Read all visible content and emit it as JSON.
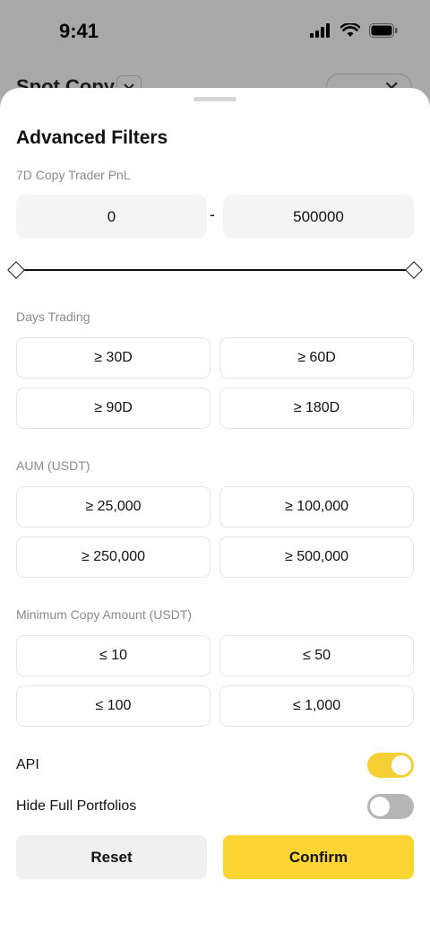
{
  "status_bar": {
    "time": "9:41"
  },
  "background": {
    "title": "Spot Copy"
  },
  "sheet": {
    "title": "Advanced Filters",
    "pnl": {
      "label": "7D Copy Trader PnL",
      "min": "0",
      "max": "500000",
      "separator": "-"
    },
    "days_trading": {
      "label": "Days Trading",
      "options": [
        "≥ 30D",
        "≥ 60D",
        "≥ 90D",
        "≥ 180D"
      ]
    },
    "aum": {
      "label": "AUM (USDT)",
      "options": [
        "≥ 25,000",
        "≥ 100,000",
        "≥ 250,000",
        "≥ 500,000"
      ]
    },
    "min_copy": {
      "label": "Minimum Copy Amount (USDT)",
      "options": [
        "≤ 10",
        "≤ 50",
        "≤ 100",
        "≤ 1,000"
      ]
    },
    "api": {
      "label": "API",
      "enabled": true
    },
    "hide_full": {
      "label": "Hide Full Portfolios",
      "enabled": false
    },
    "reset_label": "Reset",
    "confirm_label": "Confirm"
  },
  "colors": {
    "accent": "#fcd535",
    "toggle_on": "#f5cf34",
    "toggle_off": "#b5b5b5"
  }
}
